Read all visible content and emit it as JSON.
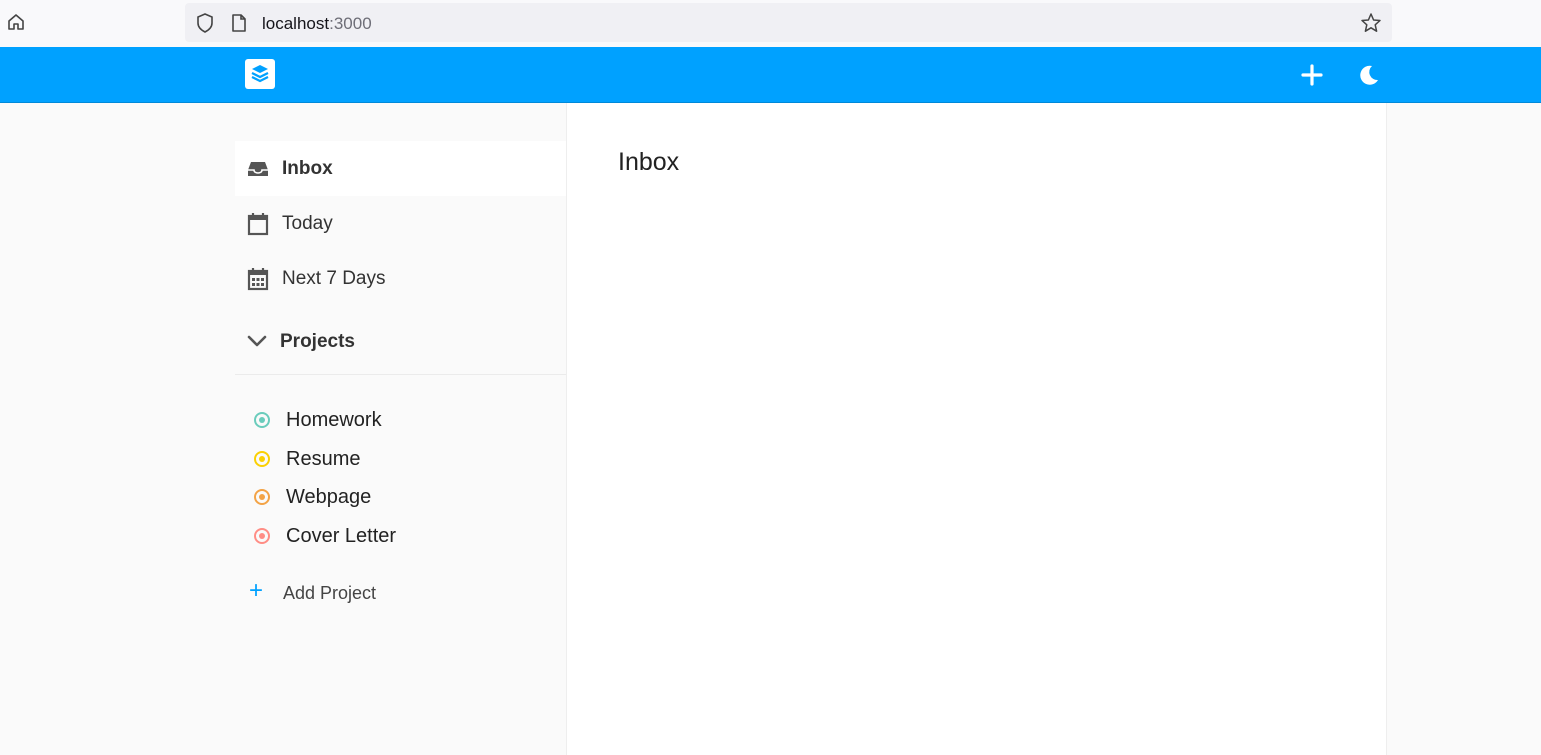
{
  "browser": {
    "url_host": "localhost",
    "url_port": ":3000"
  },
  "header": {
    "logo_icon": "checklist-stack-icon",
    "add_icon": "plus-icon",
    "theme_icon": "moon-icon",
    "background_color": "#00a1ff"
  },
  "sidebar": {
    "nav": [
      {
        "label": "Inbox",
        "icon": "inbox-icon",
        "active": true
      },
      {
        "label": "Today",
        "icon": "calendar-icon",
        "active": false
      },
      {
        "label": "Next 7 Days",
        "icon": "calendar-grid-icon",
        "active": false
      }
    ],
    "projects_label": "Projects",
    "projects": [
      {
        "name": "Homework",
        "color": "#6accbc"
      },
      {
        "name": "Resume",
        "color": "#fad003"
      },
      {
        "name": "Webpage",
        "color": "#f3a346"
      },
      {
        "name": "Cover Letter",
        "color": "#ff8d85"
      }
    ],
    "add_project_label": "Add Project"
  },
  "main": {
    "title": "Inbox"
  }
}
